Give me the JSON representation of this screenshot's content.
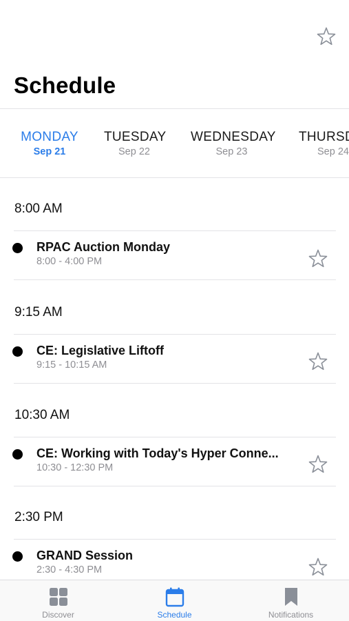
{
  "header": {
    "title": "Schedule",
    "favorite_icon": "star-outline-icon"
  },
  "day_tabs": [
    {
      "day": "MONDAY",
      "date": "Sep 21",
      "active": true
    },
    {
      "day": "TUESDAY",
      "date": "Sep 22",
      "active": false
    },
    {
      "day": "WEDNESDAY",
      "date": "Sep 23",
      "active": false
    },
    {
      "day": "THURSD",
      "date": "Sep 24",
      "active": false
    }
  ],
  "schedule": [
    {
      "time": "8:00 AM",
      "sessions": [
        {
          "title": "RPAC Auction Monday",
          "time_range": "8:00 - 4:00 PM"
        }
      ]
    },
    {
      "time": "9:15 AM",
      "sessions": [
        {
          "title": "CE: Legislative Liftoff",
          "time_range": "9:15 - 10:15 AM"
        }
      ]
    },
    {
      "time": "10:30 AM",
      "sessions": [
        {
          "title": "CE: Working with Today's Hyper Conne...",
          "time_range": "10:30 - 12:30 PM"
        }
      ]
    },
    {
      "time": "2:30 PM",
      "sessions": [
        {
          "title": "GRAND Session",
          "time_range": "2:30 - 4:30 PM"
        }
      ]
    }
  ],
  "tab_bar": {
    "items": [
      {
        "label": "Discover",
        "icon": "grid-icon",
        "active": false
      },
      {
        "label": "Schedule",
        "icon": "calendar-icon",
        "active": true
      },
      {
        "label": "Notifications",
        "icon": "bookmark-icon",
        "active": false
      }
    ]
  },
  "colors": {
    "accent": "#2b7de9",
    "secondary_text": "#8e8e93",
    "separator": "#e3e3e6",
    "icon_gray": "#8a8f98"
  }
}
